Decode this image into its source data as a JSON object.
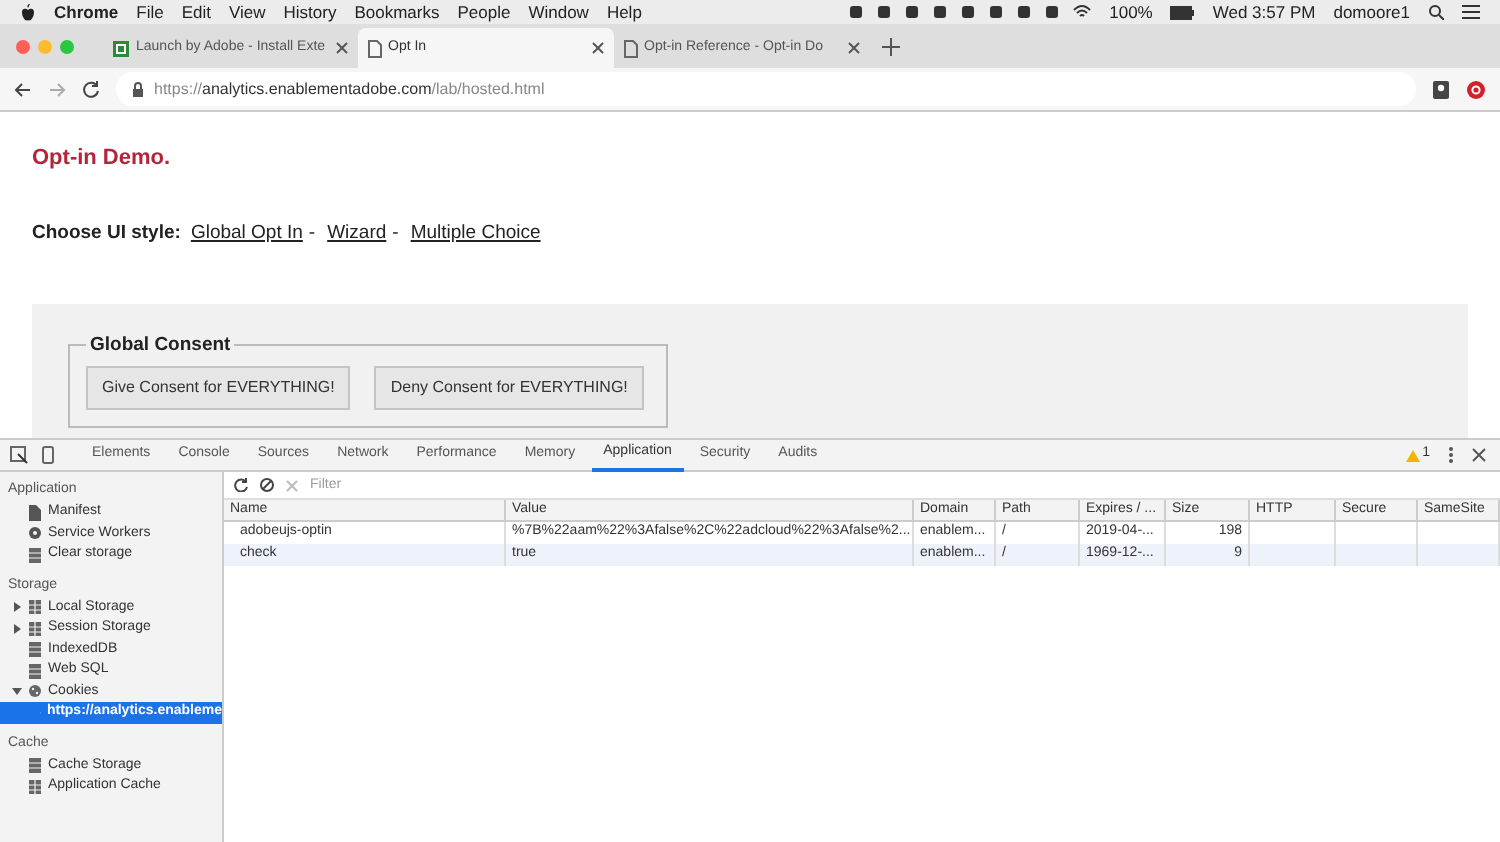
{
  "menu_bar": {
    "app": "Chrome",
    "items": [
      "File",
      "Edit",
      "View",
      "History",
      "Bookmarks",
      "People",
      "Window",
      "Help"
    ],
    "battery": "100%",
    "clock": "Wed 3:57 PM",
    "user": "domoore1"
  },
  "browser_tabs": [
    {
      "title": "Launch by Adobe - Install Exte",
      "selected": false,
      "kind": "launch"
    },
    {
      "title": "Opt In",
      "selected": true,
      "kind": "page"
    },
    {
      "title": "Opt-in Reference - Opt-in Do",
      "selected": false,
      "kind": "page"
    }
  ],
  "address_bar": {
    "scheme": "https://",
    "host": "analytics.enablementadobe.com",
    "path": "/lab/hosted.html"
  },
  "page": {
    "heading": "Opt-in Demo.",
    "ui_style_label": "Choose UI style:",
    "ui_style_links": [
      "Global Opt In",
      "Wizard",
      "Multiple Choice"
    ],
    "separator": "-",
    "fieldset_legend": "Global Consent",
    "buttons": [
      "Give Consent for EVERYTHING!",
      "Deny Consent for EVERYTHING!"
    ]
  },
  "devtools": {
    "tabs": [
      {
        "label": "Elements",
        "selected": false
      },
      {
        "label": "Console",
        "selected": false
      },
      {
        "label": "Sources",
        "selected": false
      },
      {
        "label": "Network",
        "selected": false
      },
      {
        "label": "Performance",
        "selected": false
      },
      {
        "label": "Memory",
        "selected": false
      },
      {
        "label": "Application",
        "selected": true
      },
      {
        "label": "Security",
        "selected": false
      },
      {
        "label": "Audits",
        "selected": false
      }
    ],
    "warning_count": "1",
    "sidebar": [
      {
        "title": "Application",
        "items": [
          {
            "label": "Manifest",
            "kind": "file",
            "selected": false
          },
          {
            "label": "Service Workers",
            "kind": "gear",
            "selected": false
          },
          {
            "label": "Clear storage",
            "kind": "db",
            "selected": false
          }
        ]
      },
      {
        "title": "Storage",
        "items": [
          {
            "label": "Local Storage",
            "kind": "grid",
            "selected": false,
            "expanded": false
          },
          {
            "label": "Session Storage",
            "kind": "grid",
            "selected": false,
            "expanded": false
          },
          {
            "label": "IndexedDB",
            "kind": "db",
            "selected": false
          },
          {
            "label": "Web SQL",
            "kind": "db",
            "selected": false
          },
          {
            "label": "Cookies",
            "kind": "cookie",
            "selected": false,
            "expanded": true,
            "children": [
              {
                "label": "https://analytics.enableme",
                "kind": "cookie",
                "selected": true
              }
            ]
          }
        ]
      },
      {
        "title": "Cache",
        "items": [
          {
            "label": "Cache Storage",
            "kind": "db",
            "selected": false
          },
          {
            "label": "Application Cache",
            "kind": "grid",
            "selected": false
          }
        ]
      }
    ],
    "filter_placeholder": "Filter",
    "table": {
      "columns": [
        "Name",
        "Value",
        "Domain",
        "Path",
        "Expires / ...",
        "Size",
        "HTTP",
        "Secure",
        "SameSite"
      ],
      "rows": [
        {
          "selected": false,
          "cells": [
            "adobeujs-optin",
            "%7B%22aam%22%3Afalse%2C%22adcloud%22%3Afalse%2...",
            "enablem...",
            "/",
            "2019-04-...",
            "198",
            "",
            "",
            ""
          ]
        },
        {
          "selected": true,
          "cells": [
            "check",
            "true",
            "enablem...",
            "/",
            "1969-12-...",
            "9",
            "",
            "",
            ""
          ]
        }
      ]
    }
  }
}
